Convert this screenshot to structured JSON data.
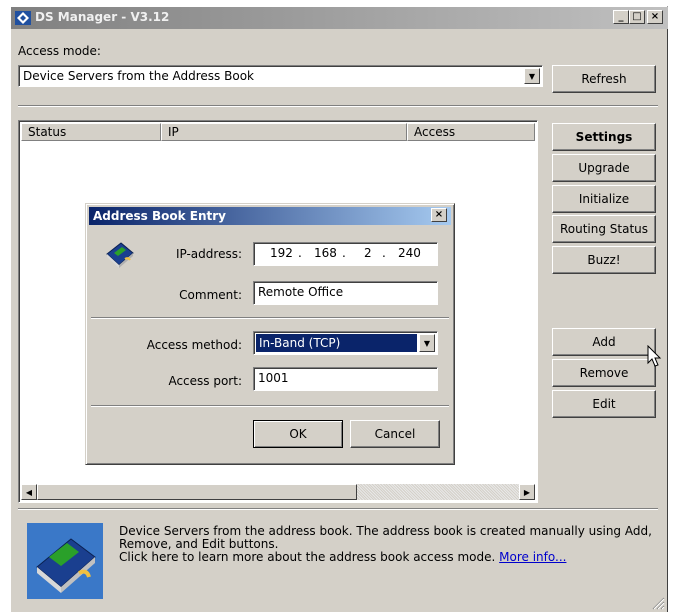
{
  "window": {
    "title": "DS Manager - V3.12",
    "caption_buttons": [
      "_",
      "□",
      "×"
    ]
  },
  "access_mode": {
    "label": "Access mode:",
    "value": "Device Servers from the Address Book",
    "refresh_label": "Refresh"
  },
  "table": {
    "columns": [
      "Status",
      "IP",
      "Access"
    ]
  },
  "side_buttons": {
    "settings": "Settings",
    "upgrade": "Upgrade",
    "initialize": "Initialize",
    "routing_status": "Routing Status",
    "buzz": "Buzz!",
    "add": "Add",
    "remove": "Remove",
    "edit": "Edit"
  },
  "dialog": {
    "title": "Address Book Entry",
    "close": "×",
    "ip_label": "IP-address:",
    "ip_parts": [
      "192",
      "168",
      "2",
      "240"
    ],
    "comment_label": "Comment:",
    "comment_value": "Remote Office",
    "access_method_label": "Access method:",
    "access_method_value": "In-Band (TCP)",
    "access_port_label": "Access port:",
    "access_port_value": "1001",
    "ok": "OK",
    "cancel": "Cancel"
  },
  "info": {
    "line1": "Device Servers from the address book. The address book is created manually using Add,",
    "line2": "Remove, and Edit buttons.",
    "line3": "Click here to learn more about the address book access mode.",
    "link": "More info..."
  },
  "icons": {
    "app": "app-icon",
    "book": "address-book-icon",
    "cursor": "mouse-cursor-icon"
  }
}
